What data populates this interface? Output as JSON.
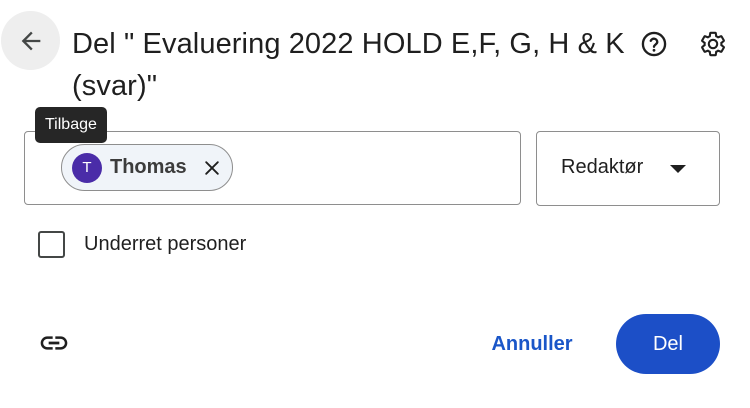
{
  "dialog": {
    "title": "Del \" Evaluering 2022 HOLD E,F, G, H & K (svar)\""
  },
  "back_button": {
    "tooltip": "Tilbage",
    "icon": "arrow-back-icon"
  },
  "header_icons": {
    "help": "help-circle-icon",
    "settings": "gear-icon"
  },
  "people": {
    "chips": [
      {
        "initial": "T",
        "name": "Thomas",
        "avatar_color": "#4a2ca8"
      }
    ]
  },
  "role": {
    "selected": "Redaktør"
  },
  "notify": {
    "label": "Underret personer",
    "checked": false
  },
  "footer": {
    "cancel_label": "Annuller",
    "share_label": "Del",
    "link_icon": "link-icon"
  },
  "colors": {
    "primary": "#1c4fc7",
    "link_text": "#1a56c8",
    "tooltip_bg": "#262626"
  }
}
